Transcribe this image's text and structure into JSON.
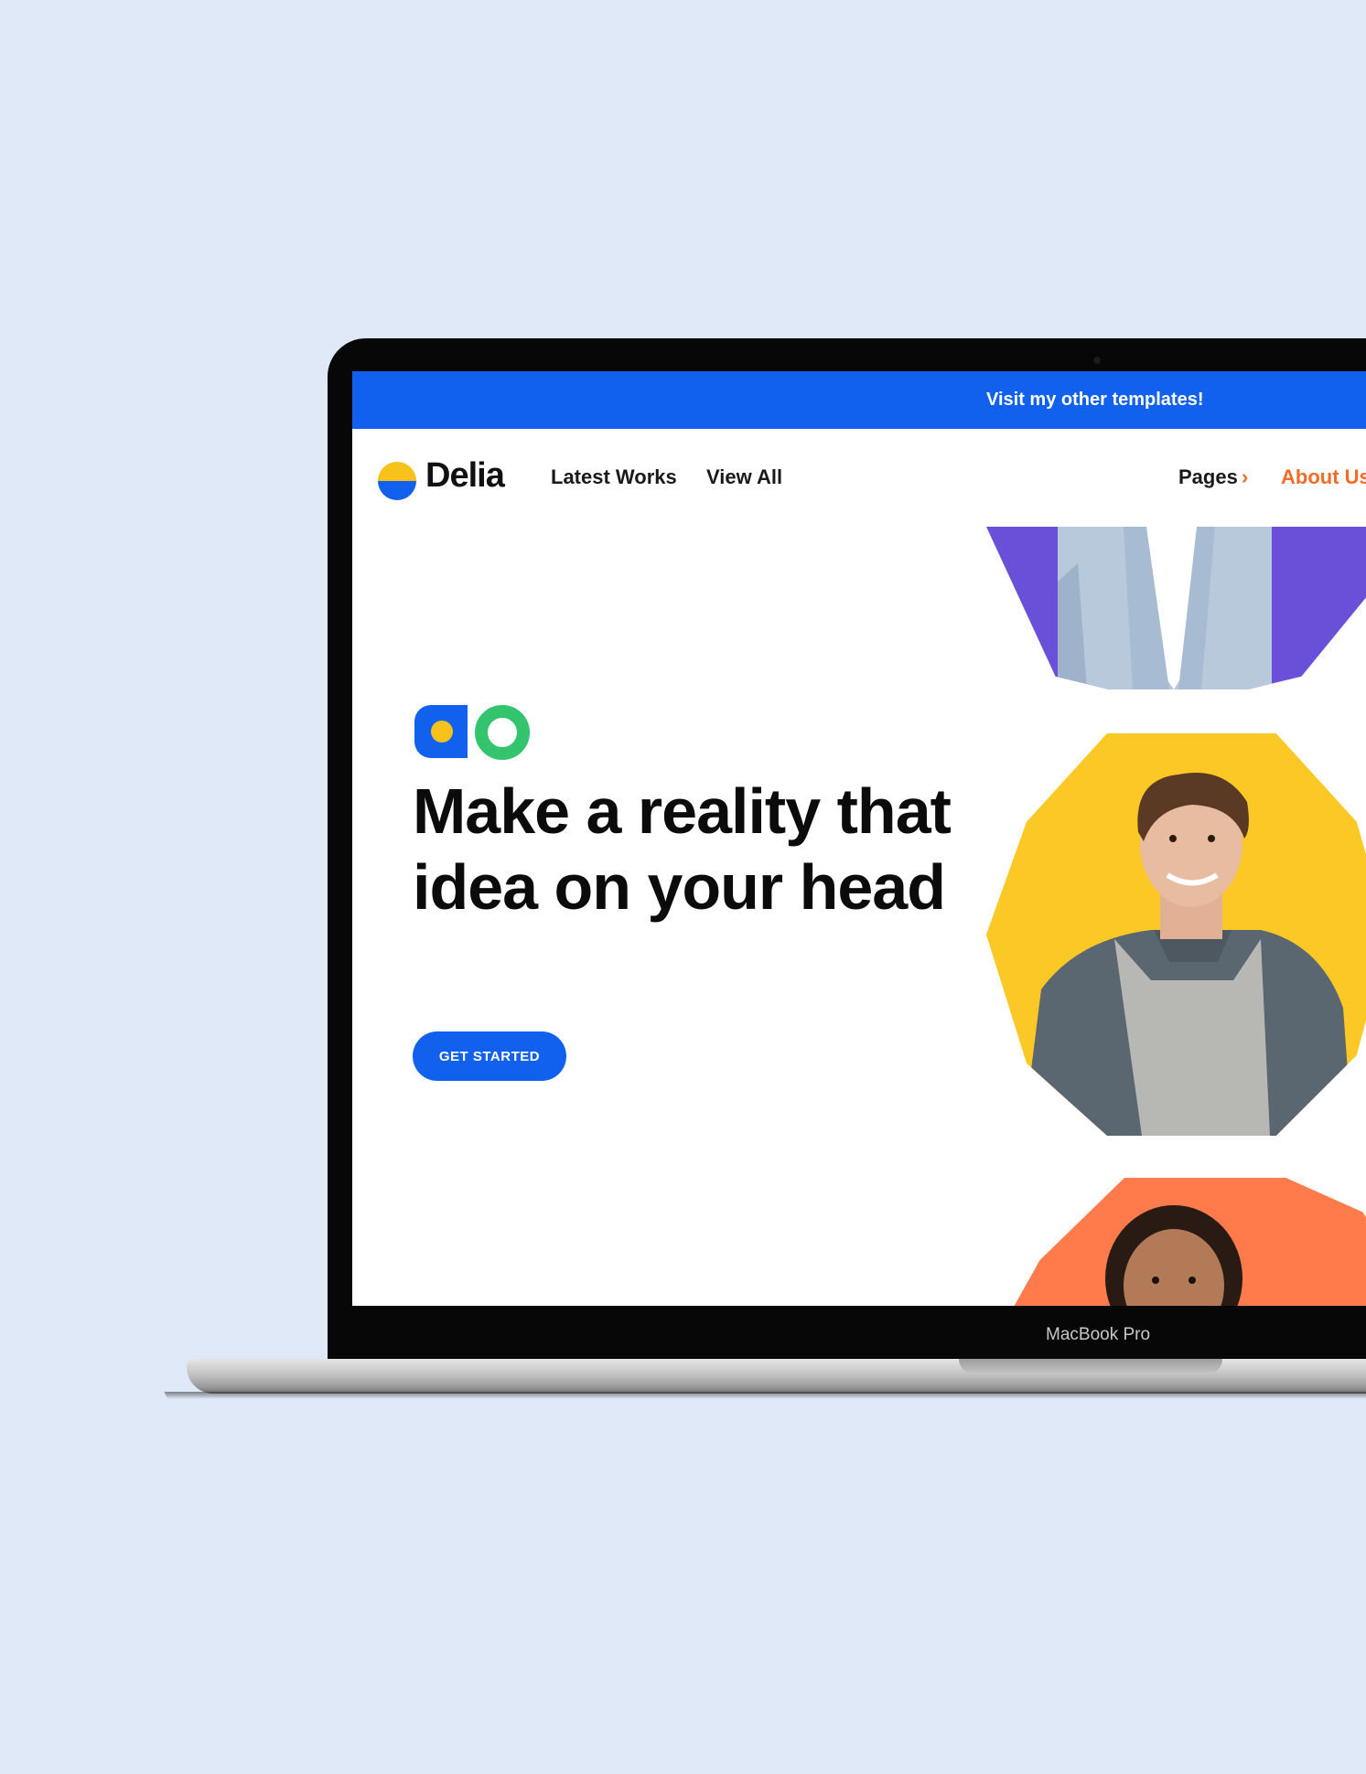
{
  "device": {
    "label": "MacBook Pro"
  },
  "promo": {
    "text": "Visit my other templates!"
  },
  "nav": {
    "logo_text": "Delia",
    "links": [
      "Latest Works",
      "View All"
    ],
    "pages_label": "Pages",
    "pages_chevron": "›",
    "about_label": "About Us"
  },
  "hero": {
    "title": "Make a reality that idea on your head",
    "cta_label": "GET STARTED"
  },
  "colors": {
    "brand_blue": "#1260ee",
    "accent_yellow": "#f8c21a",
    "accent_green": "#33c46d",
    "accent_orange": "#f26b2a",
    "blob_purple": "#6a4fd8",
    "blob_yellow": "#fcc825",
    "blob_orange": "#ff7b4b"
  },
  "icons": [
    "logo-mark-icon",
    "shape-badge-icon",
    "chevron-right-icon"
  ]
}
